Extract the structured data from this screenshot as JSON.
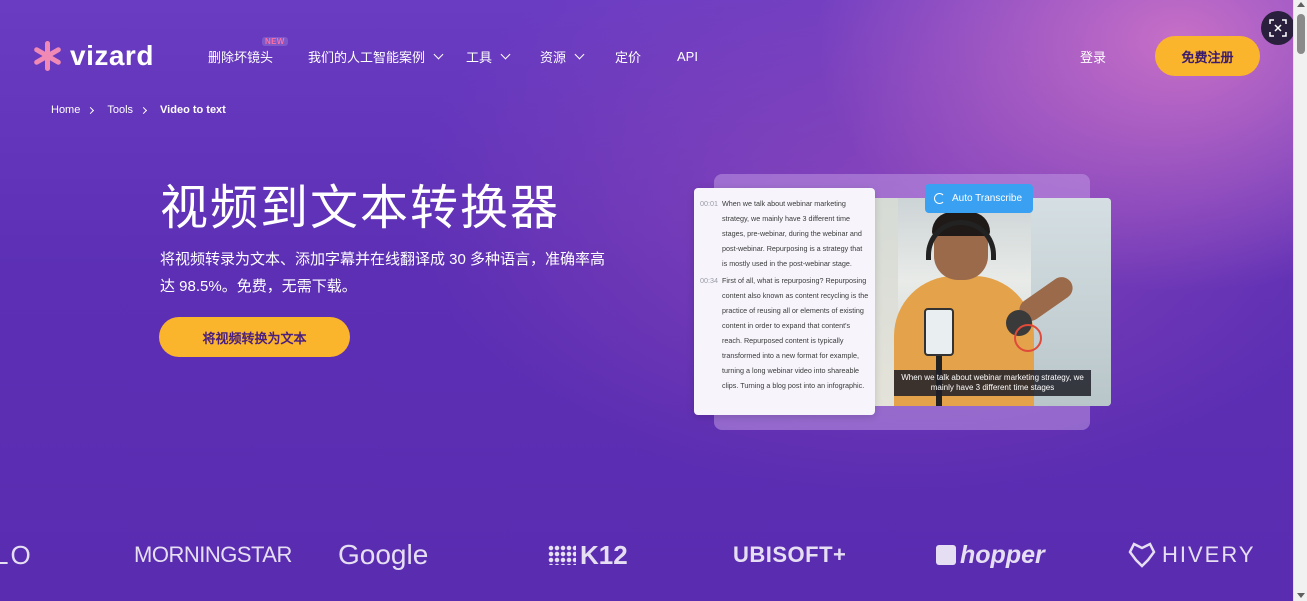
{
  "brand": {
    "name": "vizard",
    "mark_color": "#f08ab4"
  },
  "nav": {
    "items": [
      {
        "label": "删除坏镜头",
        "badge": "NEW"
      },
      {
        "label": "我们的人工智能案例",
        "has_dropdown": true
      },
      {
        "label": "工具",
        "has_dropdown": true
      },
      {
        "label": "资源",
        "has_dropdown": true
      },
      {
        "label": "定价"
      },
      {
        "label": "API"
      }
    ],
    "login": "登录",
    "signup": "免费注册"
  },
  "breadcrumb": [
    "Home",
    "Tools",
    "Video to text"
  ],
  "hero": {
    "title": "视频到文本转换器",
    "subtitle": "将视频转录为文本、添加字幕并在线翻译成 30 多种语言，准确率高达 98.5%。免费，无需下载。",
    "cta": "将视频转换为文本"
  },
  "illustration": {
    "auto_button": "Auto Transcribe",
    "transcript": [
      {
        "time": "00:01",
        "text": "When we talk about webinar marketing strategy, we mainly have 3 different time stages, pre-webinar, during the webinar and post-webinar. Repurposing is a strategy that is mostly used in the post-webinar stage."
      },
      {
        "time": "00:34",
        "text": "First of all, what is repurposing? Repurposing content also known as content recycling is the practice of reusing all or elements of existing content in order to expand that content's reach. Repurposed content is typically transformed into a new format for example, turning a long webinar video into shareable clips. Turning a blog post into an infographic."
      }
    ],
    "caption": "When we talk about webinar marketing strategy, we mainly have 3 different time stages"
  },
  "logos": [
    "LO",
    "MORNINGSTAR",
    "Google",
    "K12",
    "UBISOFT+",
    "hopper",
    "HIVERY"
  ],
  "colors": {
    "accent": "#fbb52c",
    "transcribe_button": "#3aa1f2",
    "background": "#5c2fb4"
  }
}
